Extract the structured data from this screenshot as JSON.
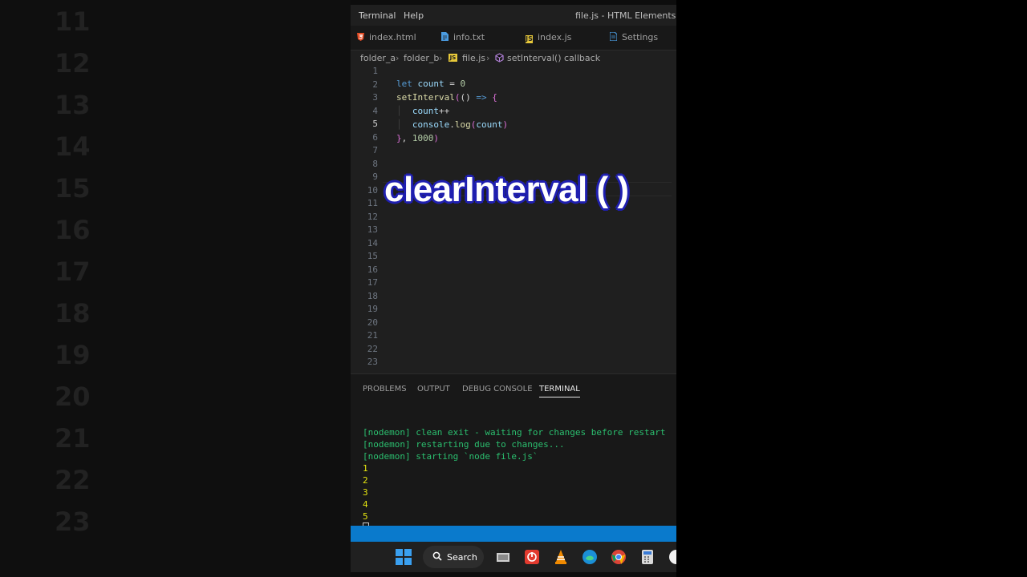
{
  "background": {
    "line_numbers": [
      "11",
      "12",
      "13",
      "14",
      "15",
      "16",
      "17",
      "18",
      "19",
      "20",
      "21",
      "22",
      "23"
    ]
  },
  "menubar": {
    "items": [
      "Terminal",
      "Help"
    ],
    "window_title": "file.js - HTML Elements - Vis"
  },
  "tabs": [
    {
      "label": "index.html",
      "icon": "html-file-icon",
      "color": "#e44d26"
    },
    {
      "label": "info.txt",
      "icon": "text-file-icon",
      "color": "#4a9be0"
    },
    {
      "label": "index.js",
      "icon": "js-file-icon",
      "color": "#e8c93a"
    },
    {
      "label": "Settings",
      "icon": "settings-file-icon",
      "color": "#4a9be0"
    }
  ],
  "breadcrumb": {
    "items": [
      "folder_a",
      "folder_b",
      "file.js",
      "setInterval() callback"
    ]
  },
  "editor": {
    "line_numbers": [
      "1",
      "2",
      "3",
      "4",
      "5",
      "6",
      "7",
      "8",
      "9",
      "10",
      "11",
      "12",
      "13",
      "14",
      "15",
      "16",
      "17",
      "18",
      "19",
      "20",
      "21",
      "22",
      "23"
    ],
    "active_line": "5"
  },
  "overlay": {
    "caption": "clearInterval ( )"
  },
  "panel": {
    "tabs": [
      "PROBLEMS",
      "OUTPUT",
      "DEBUG CONSOLE",
      "TERMINAL"
    ],
    "active_tab": "TERMINAL"
  },
  "terminal": {
    "lines": [
      "[nodemon] clean exit - waiting for changes before restart",
      "[nodemon] restarting due to changes...",
      "[nodemon] starting `node file.js`",
      "1",
      "2",
      "3",
      "4",
      "5"
    ]
  },
  "taskbar": {
    "search_label": "Search"
  },
  "colors": {
    "accent": "#0a7acc",
    "terminal_green": "#2bbf6f",
    "terminal_yellow": "#e5e510",
    "caption_outline": "#1f1fb0"
  }
}
